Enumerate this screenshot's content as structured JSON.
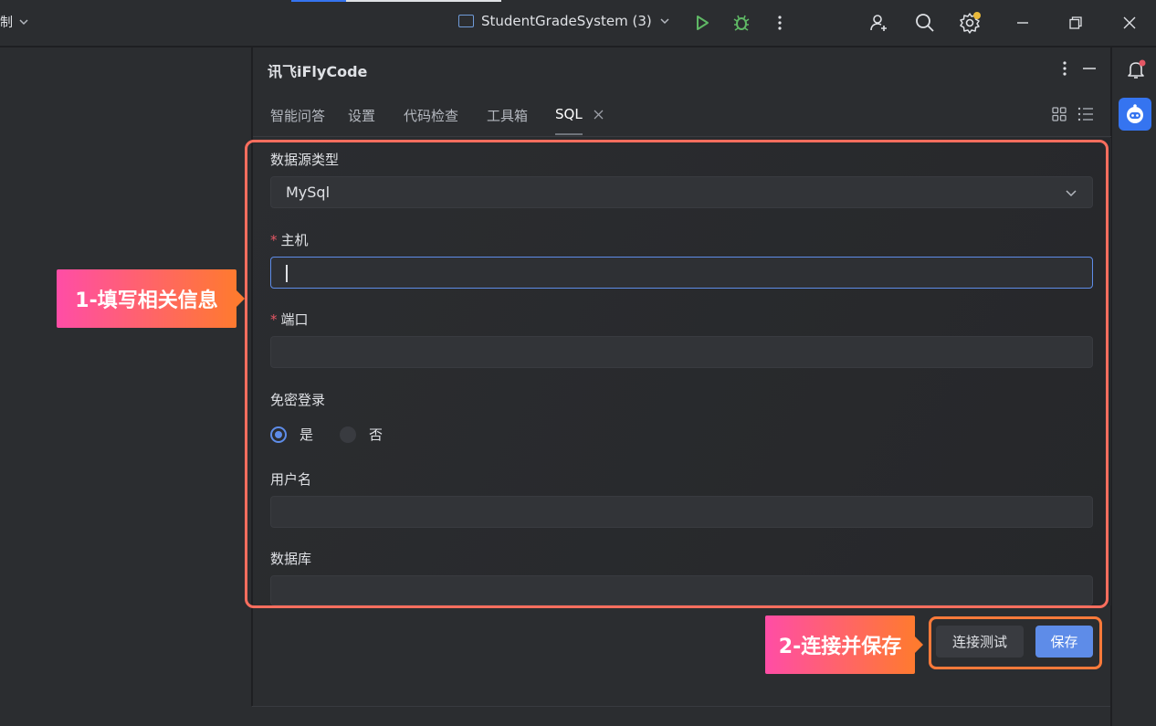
{
  "titlebar": {
    "left_label": "制",
    "project_name": "StudentGradeSystem (3)"
  },
  "panel": {
    "title": "讯飞iFlyCode",
    "tabs": [
      {
        "label": "智能问答"
      },
      {
        "label": "设置"
      },
      {
        "label": "代码检查"
      },
      {
        "label": "工具箱"
      },
      {
        "label": "SQL"
      }
    ],
    "active_tab": "SQL"
  },
  "form": {
    "datasource_label": "数据源类型",
    "datasource_value": "MySql",
    "host_label": "主机",
    "host_value": "",
    "port_label": "端口",
    "port_value": "",
    "passwordless_label": "免密登录",
    "passwordless_options": [
      {
        "label": "是",
        "selected": true
      },
      {
        "label": "否",
        "selected": false
      }
    ],
    "username_label": "用户名",
    "username_value": "",
    "database_label": "数据库",
    "database_value": "",
    "required_mark": "*"
  },
  "buttons": {
    "test_connection": "连接测试",
    "save": "保存"
  },
  "annotations": {
    "step1": "1-填写相关信息",
    "step2": "2-连接并保存"
  },
  "colors": {
    "accent": "#5e8ce8",
    "annotation_start": "#ff4da6",
    "annotation_end": "#ff7a2f",
    "run_green": "#5fb865",
    "notification_dot": "#e55765"
  },
  "icons": [
    "chevron-down-icon",
    "window-icon",
    "run-icon",
    "debug-icon",
    "more-vertical-icon",
    "add-user-icon",
    "search-icon",
    "settings-icon",
    "minimize-icon",
    "restore-icon",
    "close-icon",
    "bell-icon",
    "robot-icon",
    "grid-view-icon",
    "list-view-icon",
    "tab-close-icon"
  ]
}
